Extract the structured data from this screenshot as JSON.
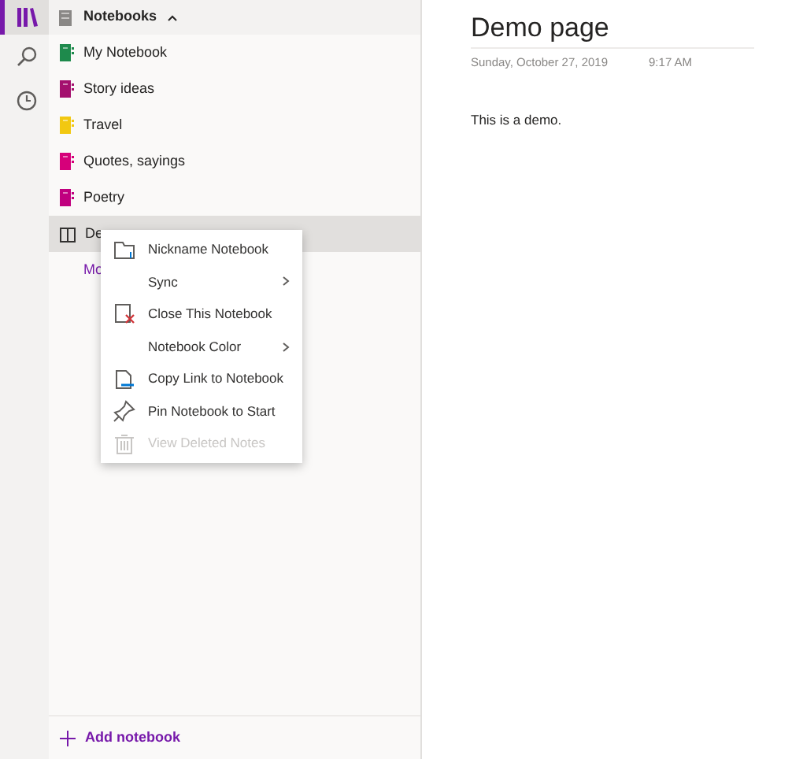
{
  "rail": [
    {
      "kind": "library",
      "selected": true
    },
    {
      "kind": "search",
      "selected": false
    },
    {
      "kind": "recent",
      "selected": false
    }
  ],
  "notebooks_header": {
    "title": "Notebooks",
    "expanded": true
  },
  "notebooks": [
    {
      "name": "My Notebook",
      "kind": "notebook",
      "color": "#1e8a4c",
      "selected": false
    },
    {
      "name": "Story ideas",
      "kind": "notebook",
      "color": "#a4106e",
      "selected": false
    },
    {
      "name": "Travel",
      "kind": "notebook",
      "color": "#f2c811",
      "selected": false
    },
    {
      "name": "Quotes, sayings",
      "kind": "notebook",
      "color": "#d6007a",
      "selected": false
    },
    {
      "name": "Poetry",
      "kind": "notebook",
      "color": "#c0007f",
      "selected": false
    },
    {
      "name": "De",
      "kind": "book",
      "selected": true
    }
  ],
  "more_link": "Mo",
  "context_menu": [
    {
      "label": "Nickname Notebook",
      "kind": "folder",
      "submenu": false,
      "disabled": false
    },
    {
      "label": "Sync",
      "submenu": true,
      "disabled": false
    },
    {
      "label": "Close This Notebook",
      "kind": "close",
      "submenu": false,
      "disabled": false
    },
    {
      "label": "Notebook Color",
      "submenu": true,
      "disabled": false
    },
    {
      "label": "Copy Link to Notebook",
      "kind": "link",
      "submenu": false,
      "disabled": false
    },
    {
      "label": "Pin Notebook to Start",
      "kind": "pin",
      "submenu": false,
      "disabled": false
    },
    {
      "label": "View Deleted Notes",
      "kind": "trash",
      "submenu": false,
      "disabled": true
    }
  ],
  "add_notebook": "Add notebook",
  "page": {
    "title": "Demo page",
    "date": "Sunday, October 27, 2019",
    "time": "9:17 AM",
    "body": "This is a demo."
  }
}
